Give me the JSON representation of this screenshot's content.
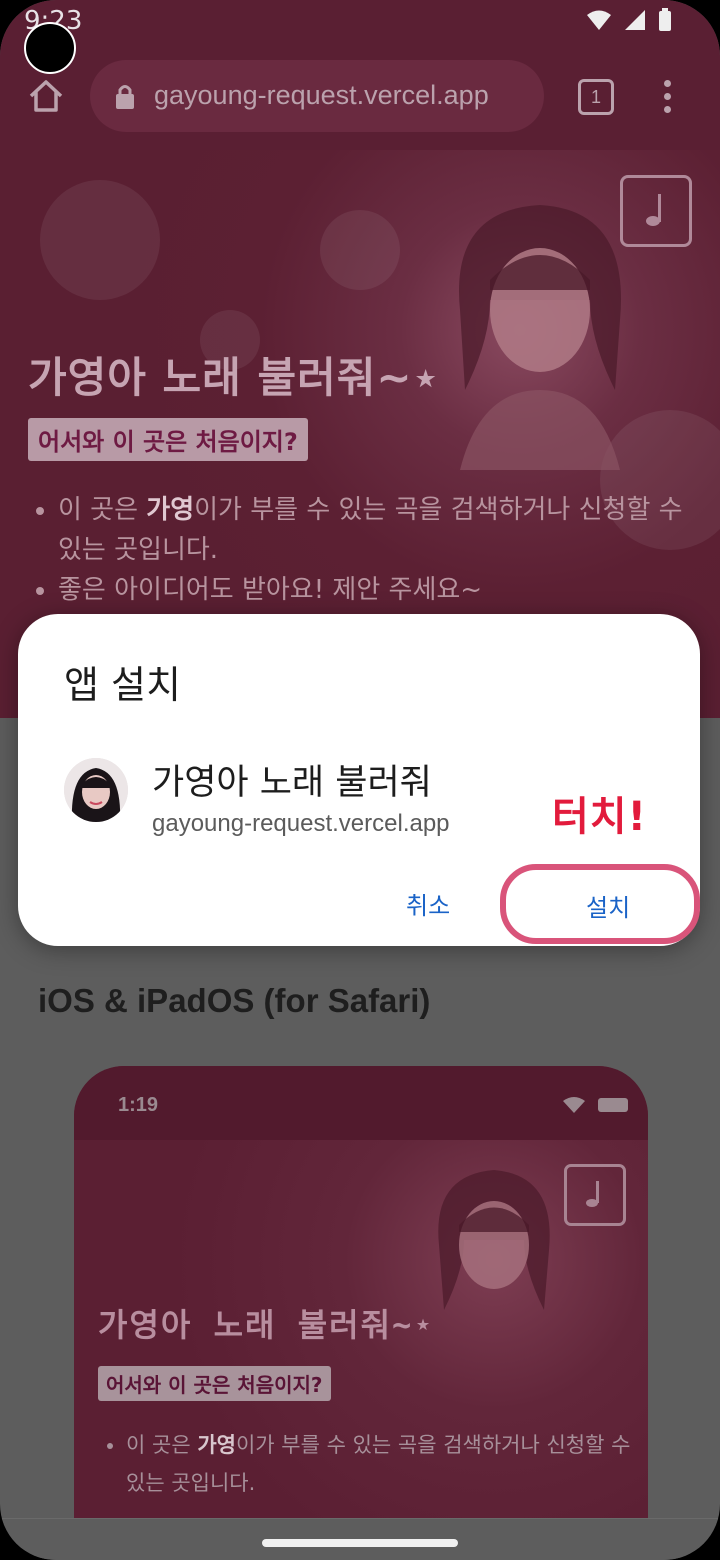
{
  "status": {
    "time": "9:23"
  },
  "browser": {
    "url": "gayoung-request.vercel.app",
    "tab_count": "1"
  },
  "hero": {
    "title": "가영아 노래 불러줘~⋆",
    "subtitle": "어서와 이 곳은 처음이지?",
    "bullet1_pre": "이 곳은 ",
    "bullet1_bold": "가영",
    "bullet1_post": "이가 부를 수 있는 곡을 검색하거나 신청할 수 있는 곳입니다.",
    "bullet2": "좋은 아이디어도 받아요! 제안 주세요~"
  },
  "section": {
    "ios_title": "iOS & iPadOS (for Safari)"
  },
  "mock": {
    "time": "1:19",
    "title": "가영아 노래 불러줘~⋆",
    "subtitle": "어서와 이 곳은 처음이지?",
    "bullet1_pre": "이 곳은 ",
    "bullet1_bold": "가영",
    "bullet1_post": "이가 부를 수 있는 곡을 검색하거나 신청할 수 있는 곳입니다."
  },
  "dialog": {
    "title": "앱 설치",
    "app_name": "가영아 노래 불러줘",
    "app_url": "gayoung-request.vercel.app",
    "cancel_label": "취소",
    "install_label": "설치",
    "annotation": "터치!"
  },
  "colors": {
    "accent_link": "#1a63c7",
    "highlight_ring": "#d9547a",
    "annotation_red": "#e21b3c",
    "brand_dark": "#5a1f33"
  },
  "icons": [
    "home-icon",
    "lock-icon",
    "tabs-icon",
    "more-vert-icon",
    "music-note-icon",
    "wifi-icon",
    "signal-icon",
    "battery-icon"
  ]
}
